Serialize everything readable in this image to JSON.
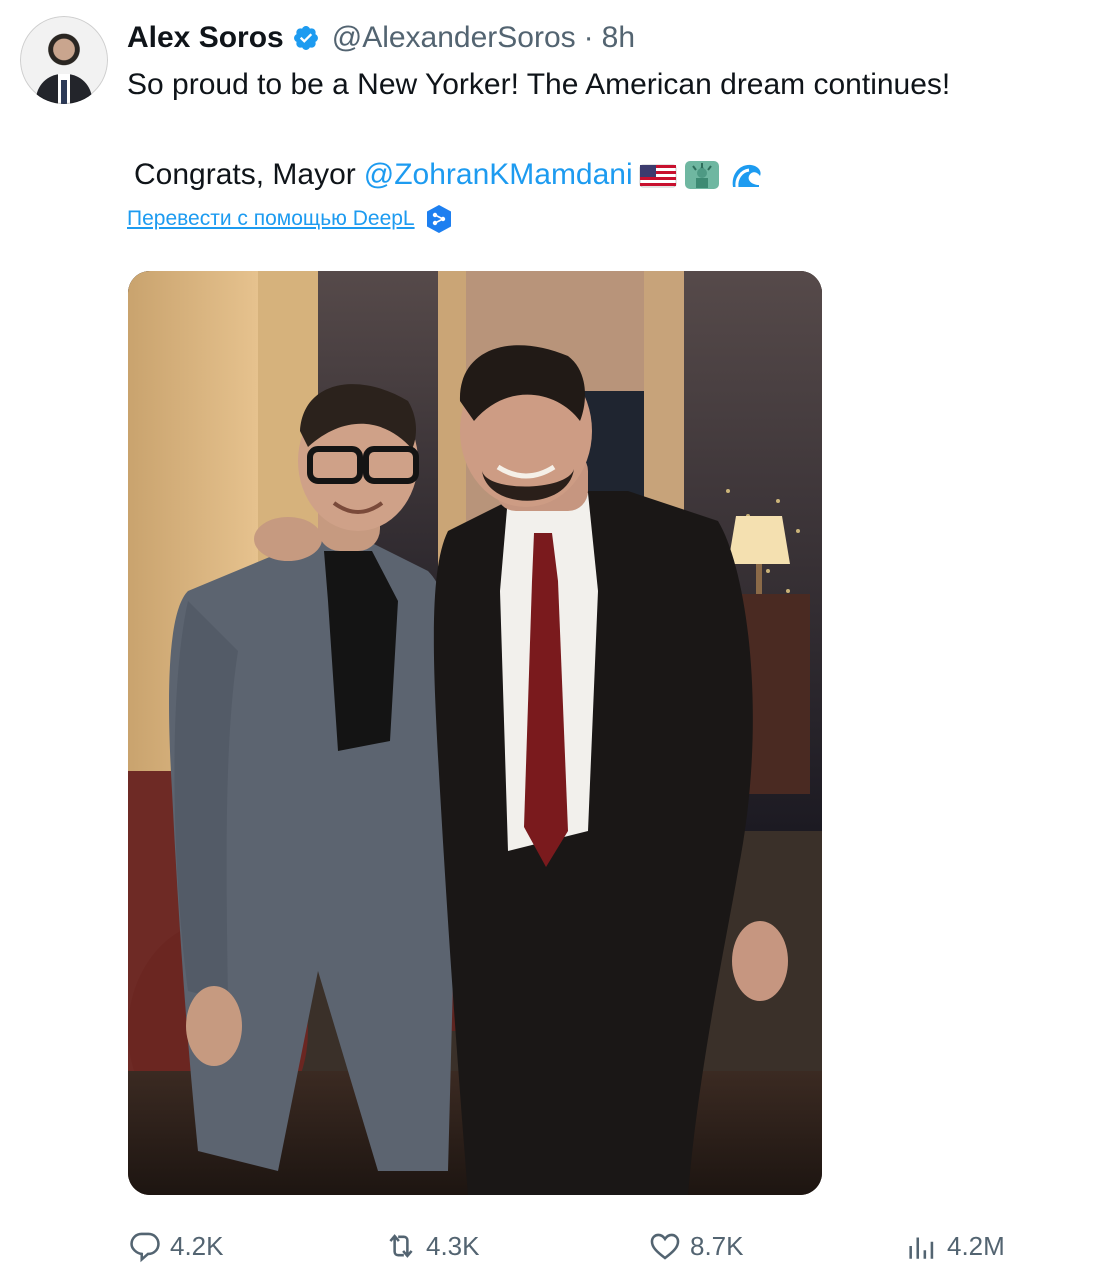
{
  "tweet": {
    "author_name": "Alex Soros",
    "handle": "@AlexanderSoros",
    "separator": "·",
    "time": "8h",
    "text": "So proud to be a New Yorker! The American dream continues!",
    "congrats_prefix": "Congrats, Mayor",
    "mention": "@ZohranKMamdani",
    "translate_link": "Перевести с помощью DeepL"
  },
  "actions": {
    "replies": "4.2K",
    "reposts": "4.3K",
    "likes": "8.7K",
    "views": "4.2M"
  },
  "colors": {
    "accent": "#1d9bf0",
    "secondary_text": "#536471",
    "text": "#0f1419"
  },
  "icons": {
    "verified": "verified-badge-icon",
    "reply": "reply-icon",
    "repost": "repost-icon",
    "like": "heart-icon",
    "views": "views-chart-icon",
    "deepl": "deepl-icon"
  }
}
